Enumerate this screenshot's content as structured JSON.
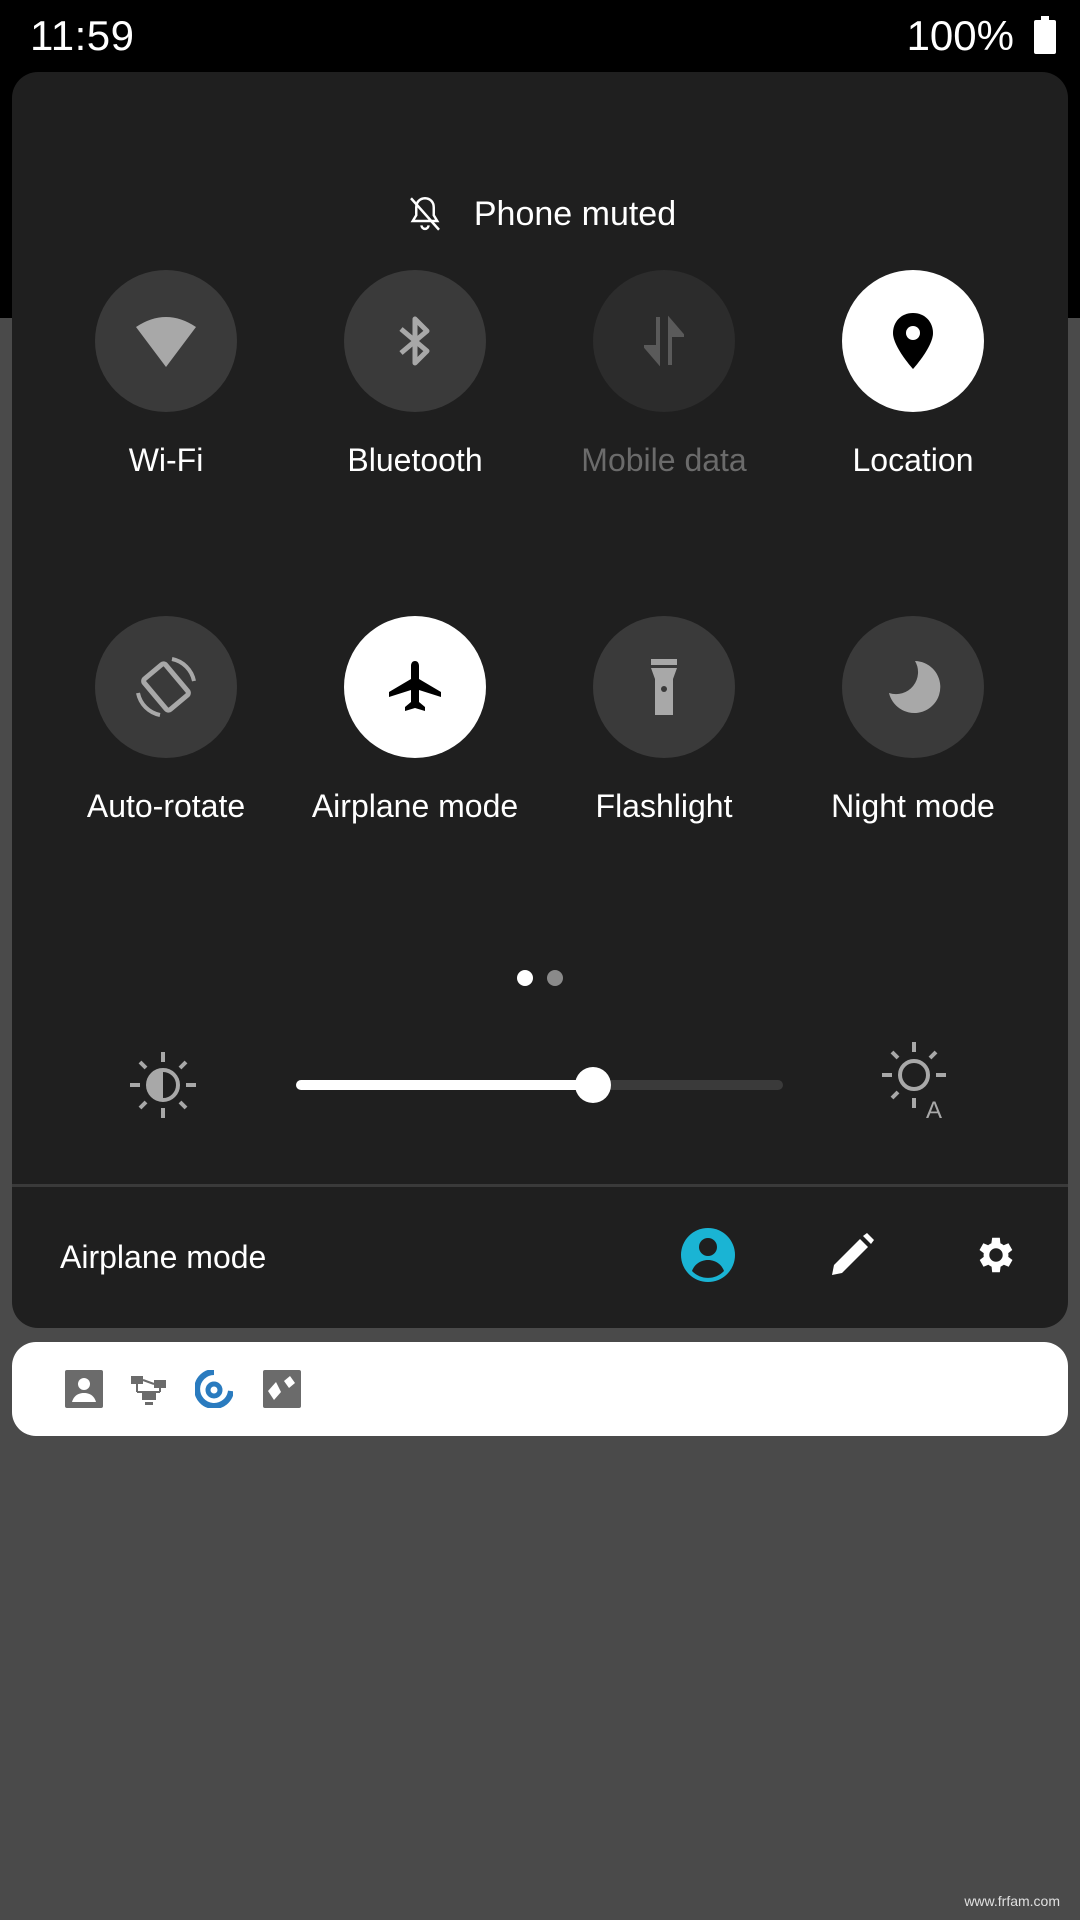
{
  "status_bar": {
    "time": "11:59",
    "battery_percent": "100%",
    "battery_icon": "battery-full-icon"
  },
  "quick_settings": {
    "dnd_status": {
      "icon": "bell-off-icon",
      "label": "Phone muted"
    },
    "tiles": [
      {
        "label": "Wi-Fi",
        "icon": "wifi-icon",
        "state": "off"
      },
      {
        "label": "Bluetooth",
        "icon": "bluetooth-icon",
        "state": "off"
      },
      {
        "label": "Mobile data",
        "icon": "mobile-data-icon",
        "state": "unavailable"
      },
      {
        "label": "Location",
        "icon": "location-pin-icon",
        "state": "on"
      },
      {
        "label": "Auto-rotate",
        "icon": "auto-rotate-icon",
        "state": "off"
      },
      {
        "label": "Airplane mode",
        "icon": "airplane-icon",
        "state": "on"
      },
      {
        "label": "Flashlight",
        "icon": "flashlight-icon",
        "state": "off"
      },
      {
        "label": "Night mode",
        "icon": "moon-icon",
        "state": "off"
      }
    ],
    "pages": {
      "count": 2,
      "current": 1
    },
    "brightness": {
      "value_fraction": 0.61,
      "left_icon": "brightness-icon",
      "right_icon": "auto-brightness-icon"
    },
    "footer": {
      "status_text": "Airplane mode",
      "buttons": [
        {
          "icon": "user-account-icon",
          "color": "#1ab4d4"
        },
        {
          "icon": "edit-pencil-icon"
        },
        {
          "icon": "settings-gear-icon"
        }
      ]
    }
  },
  "notification_card": {
    "icons": [
      "contacts-app-icon",
      "network-chat-app-icon",
      "blue-app-icon",
      "gray-app-icon"
    ]
  },
  "colors": {
    "panel_bg": "#1f1f1f",
    "tile_off": "#3a3a3a",
    "tile_on": "#ffffff",
    "accent": "#1ab4d4",
    "backdrop": "#4a4a4a"
  },
  "watermark": "www.frfam.com"
}
